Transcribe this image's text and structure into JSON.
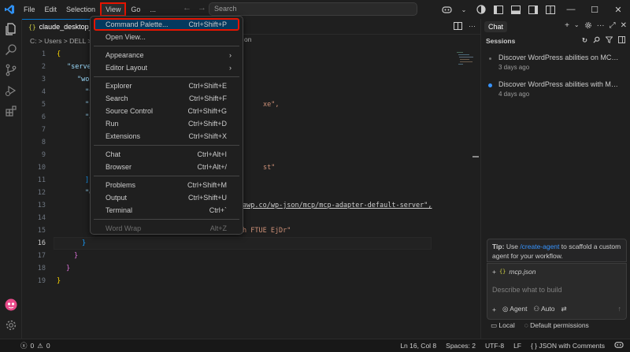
{
  "titlebar": {
    "menus": [
      "File",
      "Edit",
      "Selection",
      "View",
      "Go",
      "..."
    ],
    "active_menu": "View",
    "search_placeholder": "Search"
  },
  "editor": {
    "tab_label": "claude_desktop_c",
    "breadcrumb_left": "C: > Users > DELL > ",
    "breadcrumb_right": "on",
    "lines": [
      {
        "n": "1",
        "text": "{"
      },
      {
        "n": "2",
        "text": "\"serve"
      },
      {
        "n": "3",
        "text": "\"wor"
      },
      {
        "n": "4",
        "text": "\"t"
      },
      {
        "n": "5",
        "text": "\"c",
        "tail": "xe\","
      },
      {
        "n": "6",
        "text": "\"a"
      },
      {
        "n": "7",
        "text": ""
      },
      {
        "n": "8",
        "text": ""
      },
      {
        "n": "9",
        "text": ""
      },
      {
        "n": "10",
        "text": "",
        "tail": "st\""
      },
      {
        "n": "11",
        "text": "],"
      },
      {
        "n": "12",
        "text": "\"e"
      },
      {
        "n": "13",
        "text": "",
        "tail": "awp.co/wp-json/mcp/mcp-adapter-default-server\","
      },
      {
        "n": "14",
        "text": ""
      },
      {
        "n": "15",
        "text": "",
        "tail": "h FTUE EjDr\""
      },
      {
        "n": "16",
        "text": "}"
      },
      {
        "n": "17",
        "text": "}"
      },
      {
        "n": "18",
        "text": "}"
      },
      {
        "n": "19",
        "text": "}"
      }
    ]
  },
  "view_menu": {
    "items": [
      {
        "label": "Command Palette...",
        "shortcut": "Ctrl+Shift+P",
        "highlight": true
      },
      {
        "label": "Open View...",
        "shortcut": ""
      },
      {
        "sep": true
      },
      {
        "label": "Appearance",
        "submenu": true
      },
      {
        "label": "Editor Layout",
        "submenu": true
      },
      {
        "sep": true
      },
      {
        "label": "Explorer",
        "shortcut": "Ctrl+Shift+E"
      },
      {
        "label": "Search",
        "shortcut": "Ctrl+Shift+F"
      },
      {
        "label": "Source Control",
        "shortcut": "Ctrl+Shift+G"
      },
      {
        "label": "Run",
        "shortcut": "Ctrl+Shift+D"
      },
      {
        "label": "Extensions",
        "shortcut": "Ctrl+Shift+X"
      },
      {
        "sep": true
      },
      {
        "label": "Chat",
        "shortcut": "Ctrl+Alt+I"
      },
      {
        "label": "Browser",
        "shortcut": "Ctrl+Alt+/"
      },
      {
        "sep": true
      },
      {
        "label": "Problems",
        "shortcut": "Ctrl+Shift+M"
      },
      {
        "label": "Output",
        "shortcut": "Ctrl+Shift+U"
      },
      {
        "label": "Terminal",
        "shortcut": "Ctrl+`"
      },
      {
        "sep": true
      },
      {
        "label": "Word Wrap",
        "shortcut": "Alt+Z",
        "disabled": true
      }
    ]
  },
  "chat": {
    "tab": "Chat",
    "sessions_label": "Sessions",
    "sessions": [
      {
        "title": "Discover WordPress abilities on MCP s...",
        "time": "3 days ago",
        "dot": "#6e6e6e"
      },
      {
        "title": "Discover WordPress abilities with MCP ...",
        "time": "4 days ago",
        "dot": "#3794ff"
      }
    ],
    "tip_label": "Tip:",
    "tip_pre": "Use",
    "tip_link": "/create-agent",
    "tip_post": "to scaffold a custom agent for your workflow.",
    "attachment": "mcp.json",
    "placeholder": "Describe what to build",
    "mode": "Agent",
    "model": "Auto",
    "footer_local": "Local",
    "footer_permissions": "Default permissions"
  },
  "statusbar": {
    "errors": "0",
    "warnings": "0",
    "position": "Ln 16, Col 8",
    "spaces": "Spaces: 2",
    "encoding": "UTF-8",
    "eol": "LF",
    "language": "JSON with Comments"
  },
  "colors": {
    "accent": "#0078d4",
    "highlight_border": "#e51400",
    "link": "#3794ff"
  }
}
